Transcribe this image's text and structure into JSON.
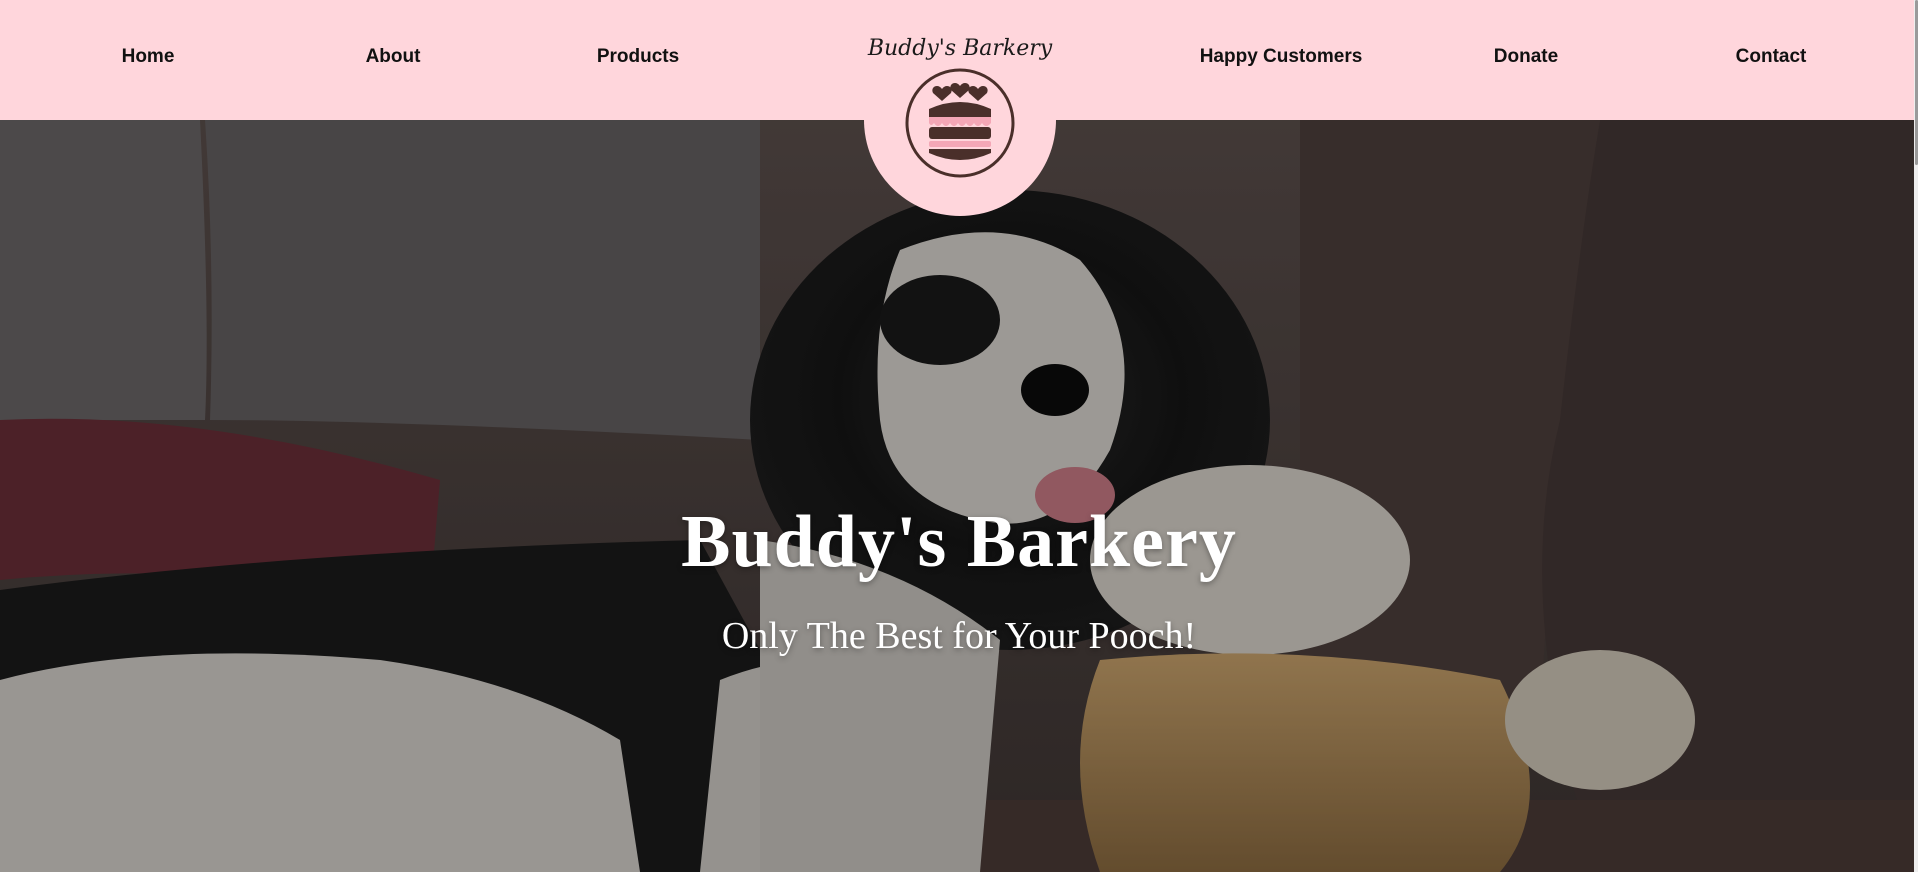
{
  "nav": {
    "items": [
      {
        "label": "Home"
      },
      {
        "label": "About"
      },
      {
        "label": "Products"
      },
      {
        "label": "Happy Customers"
      },
      {
        "label": "Donate"
      },
      {
        "label": "Contact"
      }
    ],
    "logo_text": "Buddy's Barkery",
    "logo_icon": "layered-cake-with-hearts-icon"
  },
  "hero": {
    "title": "Buddy's Barkery",
    "subtitle": "Only The Best for Your Pooch!",
    "image": "dog-on-couch-with-plush-toy"
  },
  "colors": {
    "nav_bg": "#ffd6dc",
    "logo_brown": "#4a2f2a",
    "logo_pink": "#f4a7b6",
    "text_dark": "#111111",
    "hero_text": "#ffffff"
  }
}
